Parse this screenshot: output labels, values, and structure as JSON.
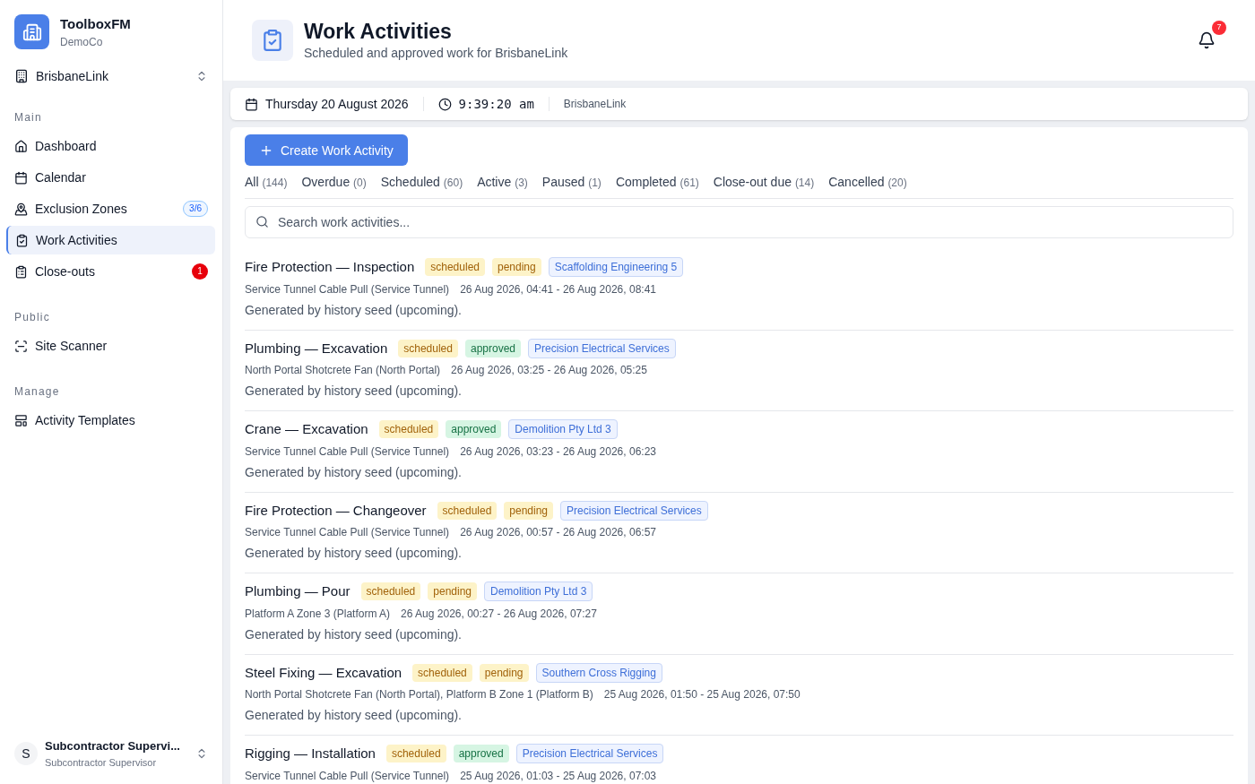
{
  "brand": {
    "name": "ToolboxFM",
    "org": "DemoCo"
  },
  "site_selector": {
    "value": "BrisbaneLink"
  },
  "sidebar": {
    "sections": [
      {
        "title": "Main",
        "items": [
          {
            "label": "Dashboard",
            "selected": false
          },
          {
            "label": "Calendar",
            "selected": false
          },
          {
            "label": "Exclusion Zones",
            "selected": false,
            "badge": {
              "text": "3/6",
              "kind": "info"
            }
          },
          {
            "label": "Work Activities",
            "selected": true
          },
          {
            "label": "Close-outs",
            "selected": false,
            "badge": {
              "text": "1",
              "kind": "alert"
            }
          }
        ]
      },
      {
        "title": "Public",
        "items": [
          {
            "label": "Site Scanner",
            "selected": false
          }
        ]
      },
      {
        "title": "Manage",
        "items": [
          {
            "label": "Activity Templates",
            "selected": false
          }
        ]
      }
    ]
  },
  "user": {
    "initial": "S",
    "name": "Subcontractor Supervi...",
    "role": "Subcontractor Supervisor"
  },
  "header": {
    "title": "Work Activities",
    "subtitle": "Scheduled and approved work for BrisbaneLink",
    "notifications": "7"
  },
  "info_bar": {
    "date": "Thursday 20 August 2026",
    "time": "9:39:20 am",
    "site": "BrisbaneLink"
  },
  "create_button": "Create Work Activity",
  "tabs": [
    {
      "label": "All",
      "count": "(144)"
    },
    {
      "label": "Overdue",
      "count": "(0)"
    },
    {
      "label": "Scheduled",
      "count": "(60)"
    },
    {
      "label": "Active",
      "count": "(3)"
    },
    {
      "label": "Paused",
      "count": "(1)"
    },
    {
      "label": "Completed",
      "count": "(61)"
    },
    {
      "label": "Close-out due",
      "count": "(14)"
    },
    {
      "label": "Cancelled",
      "count": "(20)"
    }
  ],
  "search": {
    "placeholder": "Search work activities..."
  },
  "activities": [
    {
      "title": "Fire Protection — Inspection",
      "badges": [
        {
          "text": "scheduled",
          "kind": "warning"
        },
        {
          "text": "pending",
          "kind": "warning"
        },
        {
          "text": "Scaffolding Engineering 5",
          "kind": "info"
        }
      ],
      "location": "Service Tunnel Cable Pull (Service Tunnel)",
      "time": "26 Aug 2026, 04:41 - 26 Aug 2026, 08:41",
      "description": "Generated by history seed (upcoming)."
    },
    {
      "title": "Plumbing — Excavation",
      "badges": [
        {
          "text": "scheduled",
          "kind": "warning"
        },
        {
          "text": "approved",
          "kind": "success"
        },
        {
          "text": "Precision Electrical Services",
          "kind": "info"
        }
      ],
      "location": "North Portal Shotcrete Fan (North Portal)",
      "time": "26 Aug 2026, 03:25 - 26 Aug 2026, 05:25",
      "description": "Generated by history seed (upcoming)."
    },
    {
      "title": "Crane — Excavation",
      "badges": [
        {
          "text": "scheduled",
          "kind": "warning"
        },
        {
          "text": "approved",
          "kind": "success"
        },
        {
          "text": "Demolition Pty Ltd 3",
          "kind": "info"
        }
      ],
      "location": "Service Tunnel Cable Pull (Service Tunnel)",
      "time": "26 Aug 2026, 03:23 - 26 Aug 2026, 06:23",
      "description": "Generated by history seed (upcoming)."
    },
    {
      "title": "Fire Protection — Changeover",
      "badges": [
        {
          "text": "scheduled",
          "kind": "warning"
        },
        {
          "text": "pending",
          "kind": "warning"
        },
        {
          "text": "Precision Electrical Services",
          "kind": "info"
        }
      ],
      "location": "Service Tunnel Cable Pull (Service Tunnel)",
      "time": "26 Aug 2026, 00:57 - 26 Aug 2026, 06:57",
      "description": "Generated by history seed (upcoming)."
    },
    {
      "title": "Plumbing — Pour",
      "badges": [
        {
          "text": "scheduled",
          "kind": "warning"
        },
        {
          "text": "pending",
          "kind": "warning"
        },
        {
          "text": "Demolition Pty Ltd 3",
          "kind": "info"
        }
      ],
      "location": "Platform A Zone 3 (Platform A)",
      "time": "26 Aug 2026, 00:27 - 26 Aug 2026, 07:27",
      "description": "Generated by history seed (upcoming)."
    },
    {
      "title": "Steel Fixing — Excavation",
      "badges": [
        {
          "text": "scheduled",
          "kind": "warning"
        },
        {
          "text": "pending",
          "kind": "warning"
        },
        {
          "text": "Southern Cross Rigging",
          "kind": "info"
        }
      ],
      "location": "North Portal Shotcrete Fan (North Portal), Platform B Zone 1 (Platform B)",
      "time": "25 Aug 2026, 01:50 - 25 Aug 2026, 07:50",
      "description": "Generated by history seed (upcoming)."
    },
    {
      "title": "Rigging — Installation",
      "badges": [
        {
          "text": "scheduled",
          "kind": "warning"
        },
        {
          "text": "approved",
          "kind": "success"
        },
        {
          "text": "Precision Electrical Services",
          "kind": "info"
        }
      ],
      "location": "Service Tunnel Cable Pull (Service Tunnel)",
      "time": "25 Aug 2026, 01:03 - 25 Aug 2026, 07:03"
    }
  ]
}
